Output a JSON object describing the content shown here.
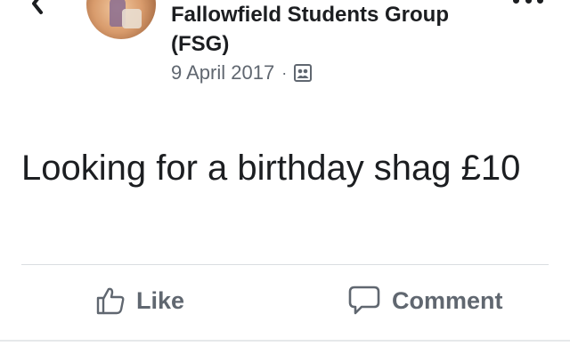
{
  "post": {
    "group_name": "Fallowfield Students Group (FSG)",
    "date": "9 April 2017",
    "separator": "·",
    "audience_icon": "group-icon",
    "text": "Looking for a birthday shag £10"
  },
  "actions": {
    "like_label": "Like",
    "comment_label": "Comment"
  },
  "icons": {
    "back": "chevron-left-icon",
    "more": "more-options-icon",
    "like": "thumbs-up-icon",
    "comment": "speech-bubble-icon"
  },
  "colors": {
    "text": "#1c1e21",
    "secondary": "#606770",
    "divider": "#dadde1"
  }
}
